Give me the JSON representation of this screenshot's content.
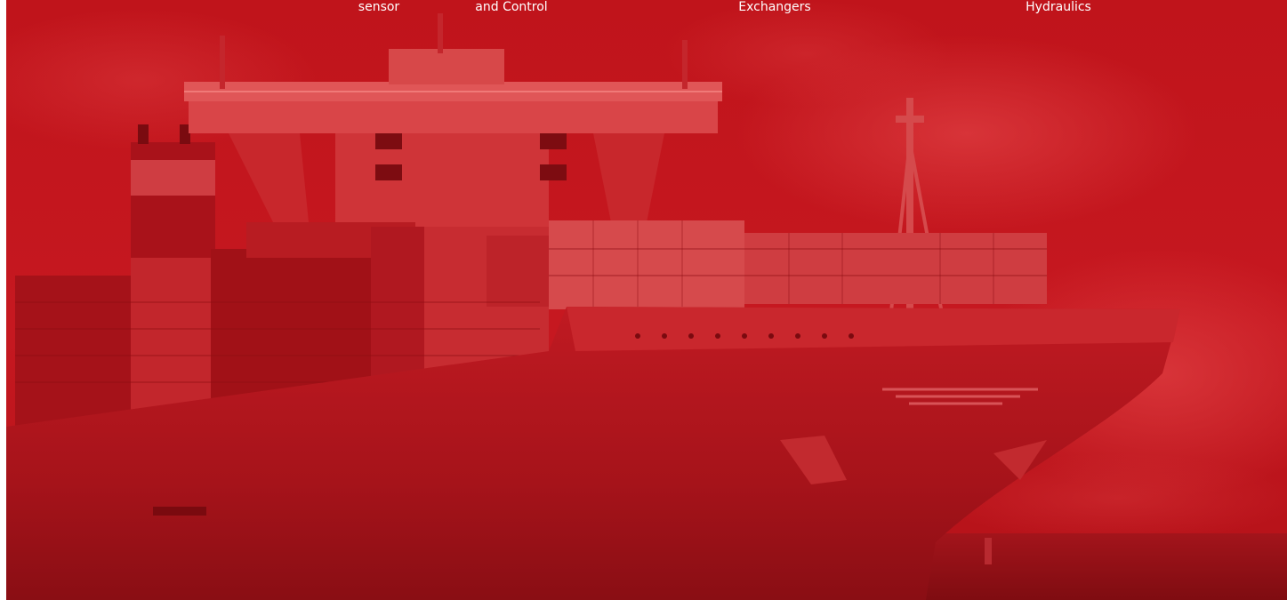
{
  "hero": {
    "colors": {
      "overlay": "#b81118",
      "sky": "#c8151d",
      "shadow": "#8e0d12",
      "highlight": "#de4b4d",
      "sea": "#99131a"
    }
  },
  "nav": {
    "items": [
      {
        "line1": "",
        "line2": "sensor"
      },
      {
        "line1": "",
        "line2": "and Control"
      },
      {
        "line1": "",
        "line2": "Exchangers"
      },
      {
        "line1": "",
        "line2": "Hydraulics"
      }
    ]
  }
}
